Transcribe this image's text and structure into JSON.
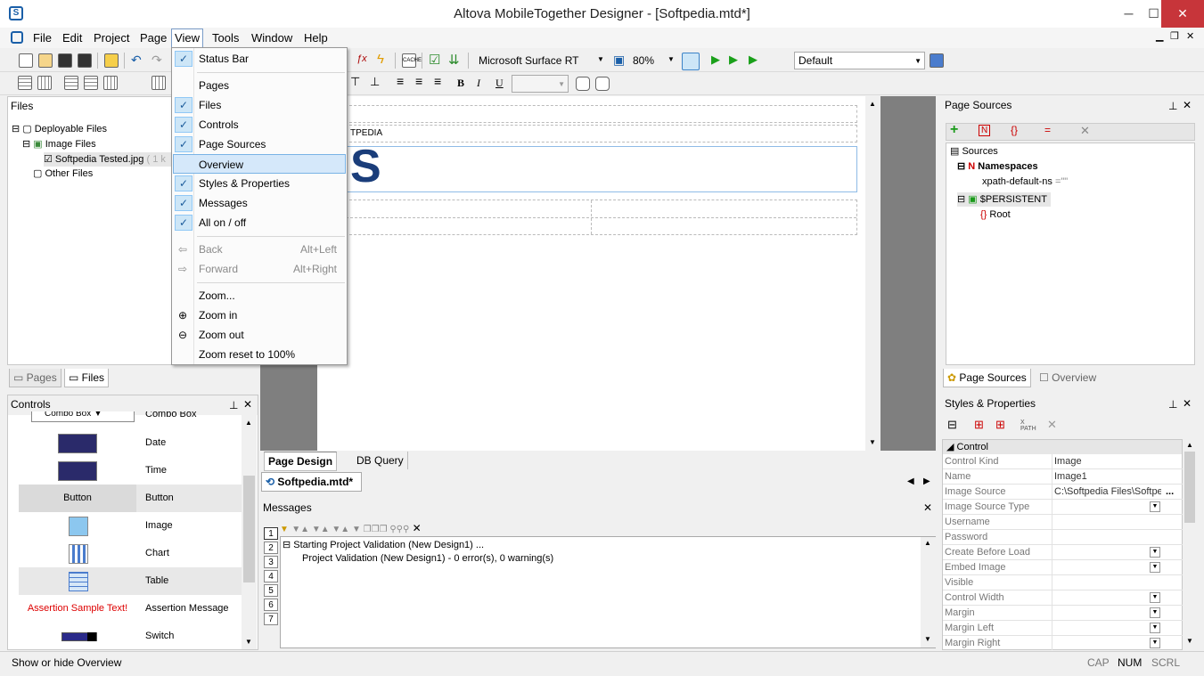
{
  "window": {
    "title": "Altova MobileTogether Designer - [Softpedia.mtd*]",
    "minimize": "─",
    "maximize": "☐",
    "close": "✕"
  },
  "menubar": {
    "items": [
      "File",
      "Edit",
      "Project",
      "Page",
      "View",
      "Tools",
      "Window",
      "Help"
    ],
    "active": "View"
  },
  "toolbar": {
    "device": "Microsoft Surface RT",
    "zoom": "80%",
    "style": "Default"
  },
  "view_menu": {
    "items": [
      {
        "label": "Status Bar",
        "checked": true
      },
      {
        "label": "Pages",
        "checked": false
      },
      {
        "label": "Files",
        "checked": true
      },
      {
        "label": "Controls",
        "checked": true
      },
      {
        "label": "Page Sources",
        "checked": true
      },
      {
        "label": "Overview",
        "checked": false
      },
      {
        "label": "Styles & Properties",
        "checked": true
      },
      {
        "label": "Messages",
        "checked": true
      },
      {
        "label": "All on / off",
        "checked": true
      },
      {
        "label": "Back",
        "shortcut": "Alt+Left"
      },
      {
        "label": "Forward",
        "shortcut": "Alt+Right"
      },
      {
        "label": "Zoom..."
      },
      {
        "label": "Zoom in"
      },
      {
        "label": "Zoom out"
      },
      {
        "label": "Zoom reset to 100%"
      }
    ]
  },
  "files_panel": {
    "title": "Files",
    "tree": [
      {
        "label": "Deployable Files"
      },
      {
        "label": "Image Files"
      },
      {
        "label": "Softpedia Tested.jpg",
        "extra": "( 1 k"
      },
      {
        "label": "Other Files"
      }
    ],
    "tabs": [
      "Pages",
      "Files"
    ]
  },
  "controls_panel": {
    "title": "Controls",
    "items": [
      "Combo Box",
      "Date",
      "Time",
      "Button",
      "Image",
      "Chart",
      "Table",
      "Assertion Message",
      "Switch"
    ],
    "button_preview": "Button",
    "assertion_preview": "Assertion Sample Text!",
    "combo_preview": "Combo Box"
  },
  "design": {
    "label_text": "TPEDIA",
    "tabs": [
      "Page Design",
      "DB Query"
    ],
    "doc_tab": "Softpedia.mtd*"
  },
  "messages": {
    "title": "Messages",
    "tabs": [
      "1",
      "2",
      "3",
      "4",
      "5",
      "6",
      "7"
    ],
    "lines": [
      "Starting Project Validation (New Design1) ...",
      "Project Validation (New Design1) - 0 error(s), 0 warning(s)"
    ]
  },
  "page_sources": {
    "title": "Page Sources",
    "tree": [
      {
        "label": "Sources"
      },
      {
        "label": "Namespaces"
      },
      {
        "label": "xpath-default-ns",
        "value": "=\"\""
      },
      {
        "label": "$PERSISTENT"
      },
      {
        "label": "Root"
      }
    ],
    "tabs": [
      "Page Sources",
      "Overview"
    ]
  },
  "styles": {
    "title": "Styles & Properties",
    "section": "Control",
    "rows": [
      {
        "k": "Control Kind",
        "v": "Image"
      },
      {
        "k": "Name",
        "v": "Image1"
      },
      {
        "k": "Image Source",
        "v": "C:\\Softpedia Files\\Softpe"
      },
      {
        "k": "Image Source Type",
        "v": ""
      },
      {
        "k": "Username",
        "v": ""
      },
      {
        "k": "Password",
        "v": ""
      },
      {
        "k": "Create Before Load",
        "v": ""
      },
      {
        "k": "Embed Image",
        "v": ""
      },
      {
        "k": "Visible",
        "v": ""
      },
      {
        "k": "Control Width",
        "v": ""
      },
      {
        "k": "Margin",
        "v": ""
      },
      {
        "k": "Margin Left",
        "v": ""
      },
      {
        "k": "Margin Right",
        "v": ""
      }
    ]
  },
  "statusbar": {
    "text": "Show or hide Overview",
    "cap": "CAP",
    "num": "NUM",
    "scrl": "SCRL"
  }
}
